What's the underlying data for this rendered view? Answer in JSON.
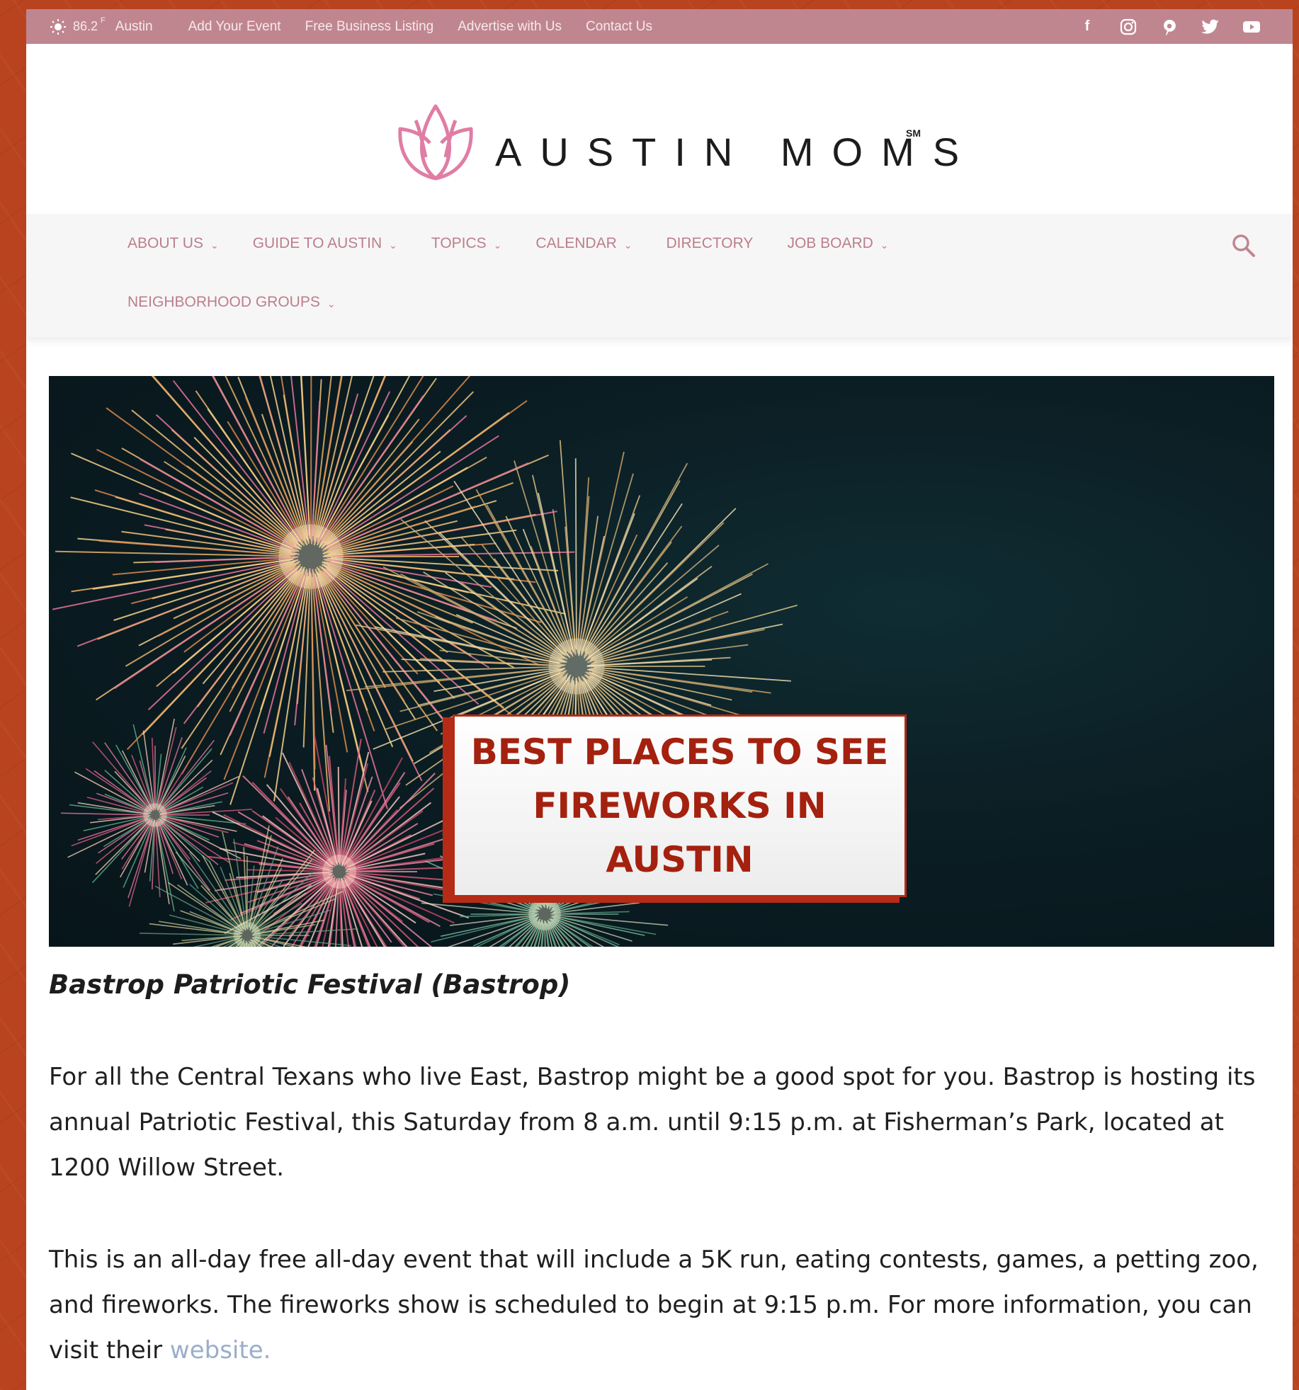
{
  "topbar": {
    "temperature": "86.2",
    "unit": "F",
    "city": "Austin",
    "links": [
      "Add Your Event",
      "Free Business Listing",
      "Advertise with Us",
      "Contact Us"
    ],
    "social_icons": [
      "facebook-icon",
      "instagram-icon",
      "pinterest-icon",
      "twitter-icon",
      "youtube-icon"
    ]
  },
  "logo": {
    "text": "AUSTIN MOMS",
    "mark": "SM"
  },
  "nav": {
    "items": [
      {
        "label": "ABOUT US",
        "dropdown": true
      },
      {
        "label": "GUIDE TO AUSTIN",
        "dropdown": true
      },
      {
        "label": "TOPICS",
        "dropdown": true
      },
      {
        "label": "CALENDAR",
        "dropdown": true
      },
      {
        "label": "DIRECTORY",
        "dropdown": false
      },
      {
        "label": "JOB BOARD",
        "dropdown": true
      },
      {
        "label": "NEIGHBORHOOD GROUPS",
        "dropdown": true
      }
    ]
  },
  "hero": {
    "badge_text": "BEST PLACES TO SEE FIREWORKS IN AUSTIN"
  },
  "article": {
    "heading": "Bastrop Patriotic Festival (Bastrop)",
    "p1": "For all the Central Texans who live East, Bastrop might be a good spot for you. Bastrop is hosting its annual Patriotic Festival, this Saturday from 8 a.m. until 9:15 p.m. at Fisherman’s Park, located at 1200 Willow Street.",
    "p2_text": "This is an all-day free all-day event that will include a 5K run, eating contests, games, a petting zoo, and fireworks. The fireworks show is scheduled to begin at 9:15 p.m. For more information, you can visit their ",
    "p2_link": "website."
  },
  "colors": {
    "background": "#b9431f",
    "topbar": "#c08690",
    "nav_text": "#bb7e8c",
    "badge_text": "#a4210f",
    "link": "#9aaecb"
  }
}
